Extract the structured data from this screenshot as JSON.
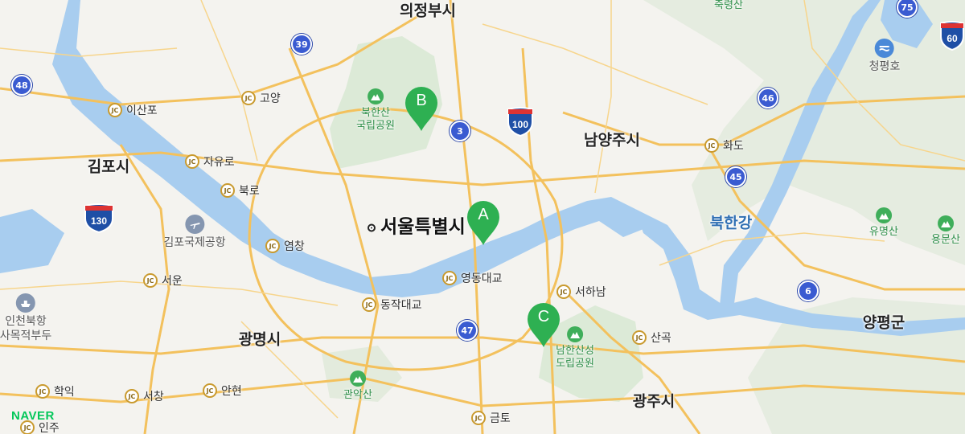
{
  "brand": "NAVER",
  "colors": {
    "marker": "#2eb052",
    "water": "#a8cdef",
    "road": "#f3c15d",
    "park": "#dcead7",
    "route_badge": "#3a5bd1"
  },
  "cities": [
    "의정부시",
    "김포시",
    "남양주시",
    "광명시",
    "광주시",
    "양평군"
  ],
  "capital": "서울특별시",
  "river": "북한강",
  "markers": [
    "A",
    "B",
    "C"
  ],
  "junctions": [
    "이산포",
    "고양",
    "자유로",
    "북로",
    "염창",
    "서운",
    "동작대교",
    "영동대교",
    "서하남",
    "화도",
    "산곡",
    "학익",
    "서창",
    "안현",
    "금토",
    "인주"
  ],
  "routes": [
    "39",
    "48",
    "3",
    "100",
    "130",
    "46",
    "45",
    "6",
    "47",
    "75",
    "60"
  ],
  "parks": [
    {
      "line1": "북한산",
      "line2": "국립공원",
      "icon": "mountain-icon"
    },
    {
      "line1": "남한산성",
      "line2": "도립공원",
      "icon": "mountain-icon"
    },
    {
      "line1": "관악산",
      "line2": "",
      "icon": "mountain-icon"
    },
    {
      "line1": "축령산",
      "line2": "",
      "icon": "mountain-icon"
    },
    {
      "line1": "유명산",
      "line2": "",
      "icon": "mountain-icon"
    },
    {
      "line1": "용문산",
      "line2": "",
      "icon": "mountain-icon"
    }
  ],
  "pois": [
    {
      "line1": "김포국제공항",
      "line2": "",
      "icon": "airplane-icon"
    },
    {
      "line1": "인천북항",
      "line2": "사목적부두",
      "icon": "ship-icon"
    },
    {
      "line1": "청평호",
      "line2": "",
      "icon": "dam-icon"
    }
  ]
}
